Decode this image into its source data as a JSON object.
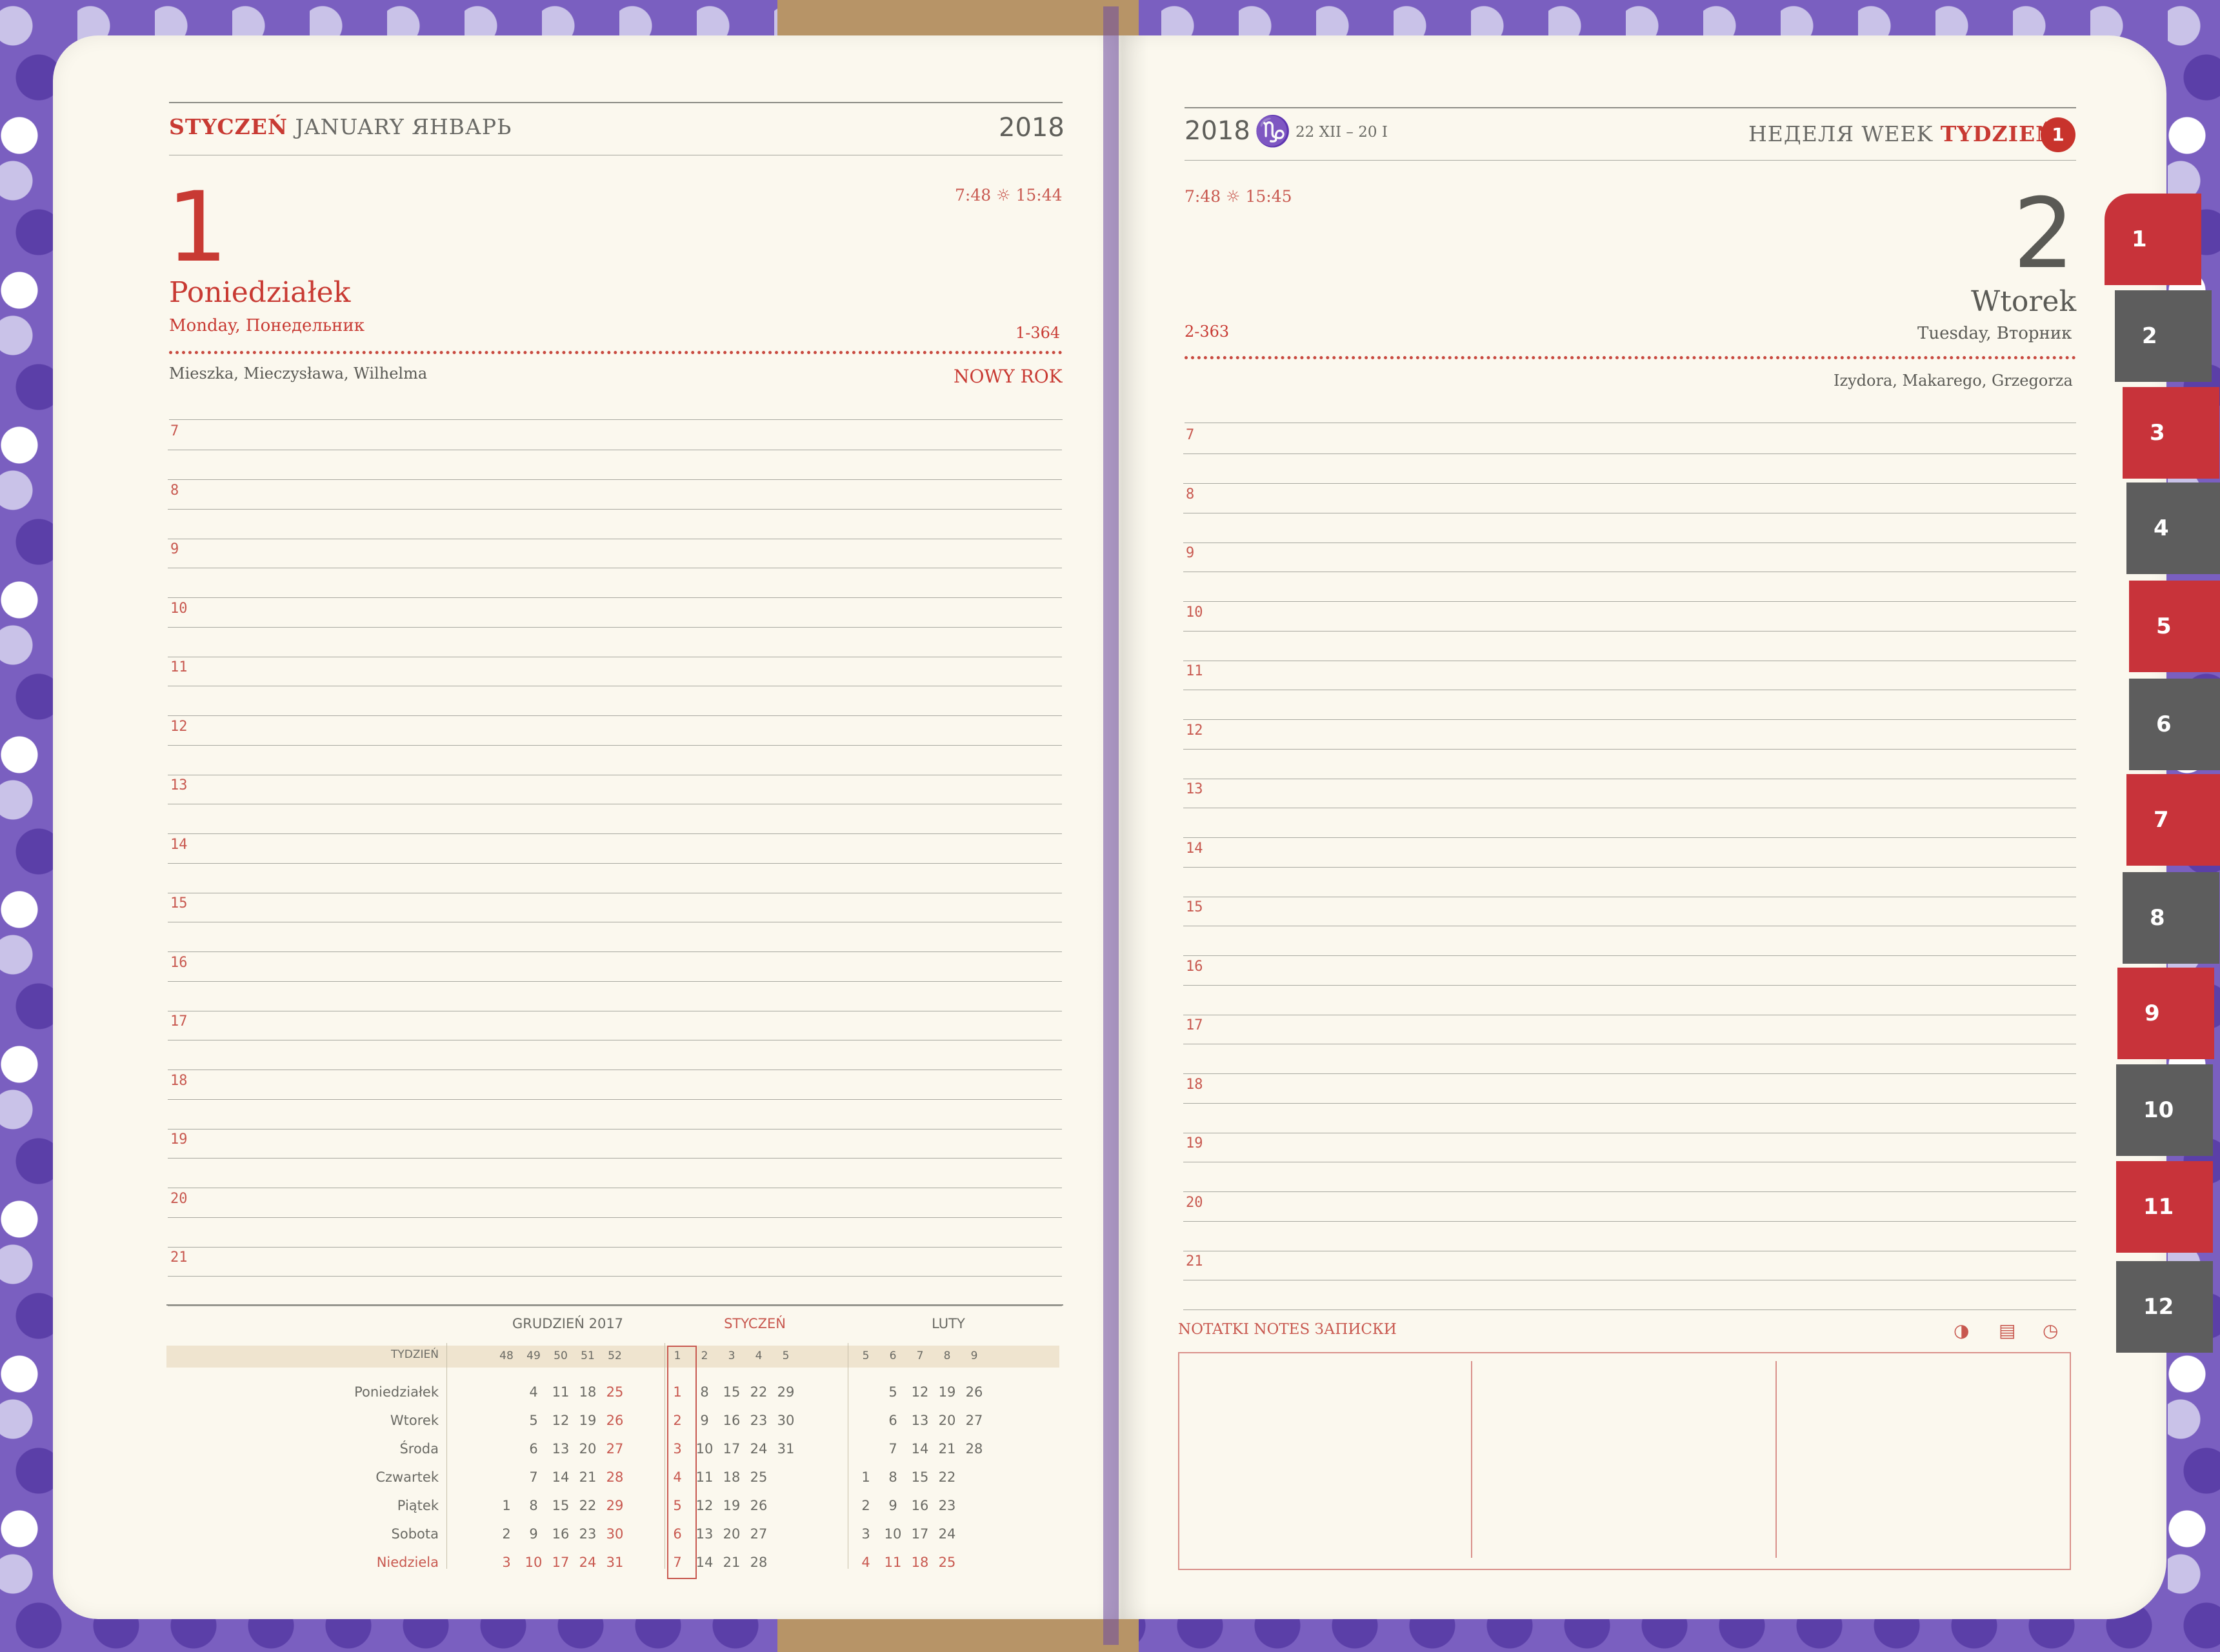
{
  "left": {
    "header": {
      "month_pl": "STYCZEŃ",
      "month_en": "JANUARY",
      "month_ru": "ЯНВАРЬ",
      "year": "2018"
    },
    "sun": {
      "rise": "7:48",
      "icon": "sun-icon",
      "icon_glyph": "☼",
      "set": "15:44"
    },
    "day_number": "1",
    "day_name": "Poniedziałek",
    "day_sub": "Monday, Понедельник",
    "day_of_year": "1-364",
    "name_days": "Mieszka, Mieczysława, Wilhelma",
    "holiday": "NOWY ROK",
    "hours": [
      "7",
      "8",
      "9",
      "10",
      "11",
      "12",
      "13",
      "14",
      "15",
      "16",
      "17",
      "18",
      "19",
      "20",
      "21"
    ]
  },
  "right": {
    "header": {
      "year": "2018",
      "zodiac_icon": "capricorn-icon",
      "zodiac_glyph": "♑",
      "zodiac_range": "22 XII – 20 I",
      "week_ru": "НЕДЕЛЯ",
      "week_en": "WEEK",
      "week_pl": "TYDZIEŃ",
      "week_number": "1"
    },
    "sun": {
      "rise": "7:48",
      "icon": "sun-icon",
      "icon_glyph": "☼",
      "set": "15:45"
    },
    "day_number": "2",
    "day_name": "Wtorek",
    "day_sub": "Tuesday, Вторник",
    "day_of_year": "2-363",
    "name_days": "Izydora, Makarego, Grzegorza",
    "hours": [
      "7",
      "8",
      "9",
      "10",
      "11",
      "12",
      "13",
      "14",
      "15",
      "16",
      "17",
      "18",
      "19",
      "20",
      "21"
    ],
    "notes_label": "NOTATKI NOTES ЗАПИСКИ",
    "notes_icons": [
      {
        "name": "moon-phase-icon",
        "glyph": "◑"
      },
      {
        "name": "document-icon",
        "glyph": "▤"
      },
      {
        "name": "clock-icon",
        "glyph": "◷"
      }
    ]
  },
  "mini_calendar": {
    "months": [
      "GRUDZIEŃ 2017",
      "STYCZEŃ",
      "LUTY"
    ],
    "week_label": "TYDZIEŃ",
    "weeks_dec": [
      "48",
      "49",
      "50",
      "51",
      "52"
    ],
    "weeks_jan": [
      "1",
      "2",
      "3",
      "4",
      "5"
    ],
    "weeks_feb": [
      "5",
      "6",
      "7",
      "8",
      "9"
    ],
    "day_names": [
      "Poniedziałek",
      "Wtorek",
      "Środa",
      "Czwartek",
      "Piątek",
      "Sobota",
      "Niedziela"
    ],
    "dec": [
      [
        "",
        "4",
        "11",
        "18",
        "25"
      ],
      [
        "",
        "5",
        "12",
        "19",
        "26"
      ],
      [
        "",
        "6",
        "13",
        "20",
        "27"
      ],
      [
        "",
        "7",
        "14",
        "21",
        "28"
      ],
      [
        "1",
        "8",
        "15",
        "22",
        "29"
      ],
      [
        "2",
        "9",
        "16",
        "23",
        "30"
      ],
      [
        "3",
        "10",
        "17",
        "24",
        "31"
      ]
    ],
    "jan": [
      [
        "1",
        "8",
        "15",
        "22",
        "29"
      ],
      [
        "2",
        "9",
        "16",
        "23",
        "30"
      ],
      [
        "3",
        "10",
        "17",
        "24",
        "31"
      ],
      [
        "4",
        "11",
        "18",
        "25",
        ""
      ],
      [
        "5",
        "12",
        "19",
        "26",
        ""
      ],
      [
        "6",
        "13",
        "20",
        "27",
        ""
      ],
      [
        "7",
        "14",
        "21",
        "28",
        ""
      ]
    ],
    "feb": [
      [
        "",
        "5",
        "12",
        "19",
        "26"
      ],
      [
        "",
        "6",
        "13",
        "20",
        "27"
      ],
      [
        "",
        "7",
        "14",
        "21",
        "28"
      ],
      [
        "1",
        "8",
        "15",
        "22",
        ""
      ],
      [
        "2",
        "9",
        "16",
        "23",
        ""
      ],
      [
        "3",
        "10",
        "17",
        "24",
        ""
      ],
      [
        "4",
        "11",
        "18",
        "25",
        ""
      ]
    ]
  },
  "tabs": [
    "1",
    "2",
    "3",
    "4",
    "5",
    "6",
    "7",
    "8",
    "9",
    "10",
    "11",
    "12"
  ],
  "colors": {
    "accent": "#c8332c",
    "tab_red": "#c8333a",
    "tab_gray": "#5d5d5d",
    "paper": "#fbf8ee"
  }
}
